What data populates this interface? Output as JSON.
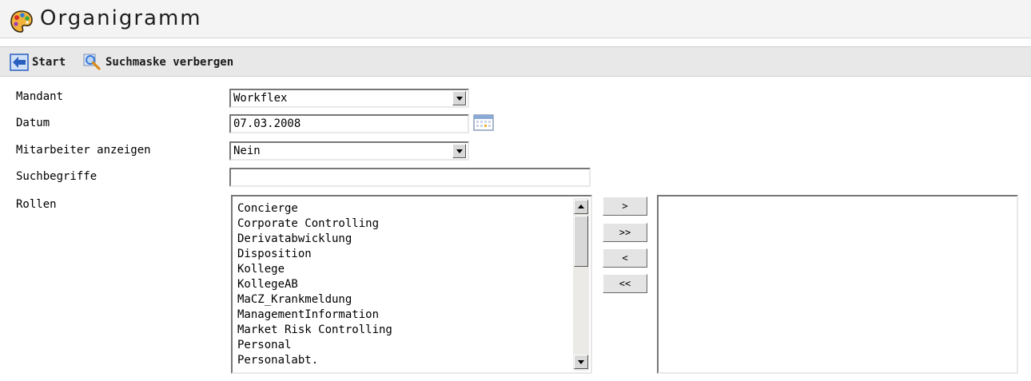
{
  "header": {
    "title": "Organigramm",
    "icon": "palette-icon"
  },
  "toolbar": {
    "start_label": "Start",
    "start_icon": "back-arrow-icon",
    "search_label": "Suchmaske verbergen",
    "search_icon": "magnifier-icon"
  },
  "form": {
    "mandant": {
      "label": "Mandant",
      "value": "Workflex"
    },
    "datum": {
      "label": "Datum",
      "value": "07.03.2008",
      "icon": "calendar-icon"
    },
    "mitarbeiter": {
      "label": "Mitarbeiter anzeigen",
      "value": "Nein"
    },
    "suchbegriffe": {
      "label": "Suchbegriffe",
      "value": ""
    },
    "rollen": {
      "label": "Rollen",
      "available": [
        "Concierge",
        "Corporate Controlling",
        "Derivatabwicklung",
        "Disposition",
        "Kollege",
        "KollegeAB",
        "MaCZ_Krankmeldung",
        "ManagementInformation",
        "Market Risk Controlling",
        "Personal",
        "Personalabt."
      ],
      "selected": [],
      "buttons": {
        "add": ">",
        "add_all": ">>",
        "remove": "<",
        "remove_all": "<<"
      }
    }
  },
  "colors": {
    "title_bar_bg": "#f4f4f4",
    "toolbar_bg": "#e8e8e8",
    "start_icon_blue": "#2a5fc0",
    "magnifier_blue": "#3b78d8"
  }
}
